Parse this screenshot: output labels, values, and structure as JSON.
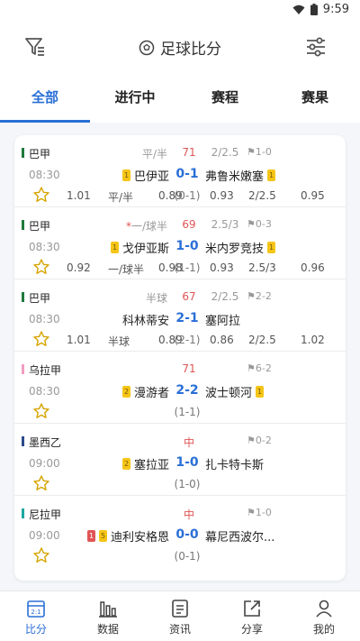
{
  "status": {
    "time": "9:59"
  },
  "header": {
    "title": "足球比分",
    "icons": {
      "left": "filter-icon",
      "title": "soccer-ball-icon",
      "right": "settings-sliders-icon"
    }
  },
  "tabs": [
    {
      "label": "全部",
      "active": true
    },
    {
      "label": "进行中",
      "active": false
    },
    {
      "label": "赛程",
      "active": false
    },
    {
      "label": "赛果",
      "active": false
    }
  ],
  "matches": [
    {
      "league": "巴甲",
      "league_color": "#1e7a3a",
      "handicap": "平/半",
      "handicap_star": "",
      "minute": "71",
      "ou_line": "2/2.5",
      "corner": "1-0",
      "time": "08:30",
      "home": "巴伊亚",
      "home_card": "1",
      "score": "0-1",
      "away": "弗鲁米嫩塞",
      "away_card": "1",
      "ht": "(0-1)",
      "odds": [
        "1.01",
        "平/半",
        "0.89",
        "0.93",
        "2/2.5",
        "0.95"
      ]
    },
    {
      "league": "巴甲",
      "league_color": "#1e7a3a",
      "handicap": "一/球半",
      "handicap_star": "*",
      "minute": "69",
      "ou_line": "2.5/3",
      "corner": "0-3",
      "time": "08:30",
      "home": "戈伊亚斯",
      "home_card": "1",
      "score": "1-0",
      "away": "米内罗竞技",
      "away_card": "1",
      "ht": "(1-1)",
      "odds": [
        "0.92",
        "一/球半",
        "0.98",
        "0.93",
        "2.5/3",
        "0.96"
      ]
    },
    {
      "league": "巴甲",
      "league_color": "#1e7a3a",
      "handicap": "半球",
      "handicap_star": "",
      "minute": "67",
      "ou_line": "2/2.5",
      "corner": "2-2",
      "time": "08:30",
      "home": "科林蒂安",
      "home_card": "",
      "score": "2-1",
      "away": "塞阿拉",
      "away_card": "",
      "ht": "(2-1)",
      "odds": [
        "1.01",
        "半球",
        "0.89",
        "0.86",
        "2/2.5",
        "1.02"
      ]
    },
    {
      "league": "乌拉甲",
      "league_color": "#f29cc0",
      "handicap": "",
      "handicap_star": "",
      "minute": "71",
      "ou_line": "",
      "corner": "6-2",
      "time": "08:30",
      "home": "漫游者",
      "home_card": "2",
      "score": "2-2",
      "away": "波士顿河",
      "away_card": "1",
      "ht": "(1-1)",
      "odds": []
    },
    {
      "league": "墨西乙",
      "league_color": "#2a4a8a",
      "handicap": "",
      "handicap_star": "",
      "minute": "中",
      "ou_line": "",
      "corner": "0-2",
      "time": "09:00",
      "home": "塞拉亚",
      "home_card": "2",
      "score": "1-0",
      "away": "扎卡特卡斯",
      "away_card": "",
      "ht": "(1-0)",
      "odds": []
    },
    {
      "league": "尼拉甲",
      "league_color": "#1aa8a0",
      "handicap": "",
      "handicap_star": "",
      "minute": "中",
      "ou_line": "",
      "corner": "1-0",
      "time": "09:00",
      "home": "迪利安格恩",
      "home_red": "1",
      "home_card": "5",
      "score": "0-0",
      "away": "幕尼西波尔...",
      "away_card": "",
      "ht": "(0-1)",
      "odds": []
    }
  ],
  "bottom_nav": [
    {
      "label": "比分",
      "icon": "scoreboard-icon",
      "active": true
    },
    {
      "label": "数据",
      "icon": "bar-chart-icon",
      "active": false
    },
    {
      "label": "资讯",
      "icon": "news-icon",
      "active": false
    },
    {
      "label": "分享",
      "icon": "share-icon",
      "active": false
    },
    {
      "label": "我的",
      "icon": "user-icon",
      "active": false
    }
  ],
  "colors": {
    "accent": "#2a6fd6",
    "live": "#e05555",
    "yellow_card": "#f5c518"
  }
}
